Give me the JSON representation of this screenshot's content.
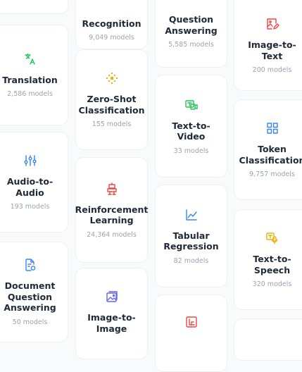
{
  "cards": [
    {
      "id": "recognition",
      "title_lines": [
        "",
        "Recognition"
      ],
      "count": "9,049 models",
      "icon": "none",
      "color": ""
    },
    {
      "id": "question-answering",
      "title_lines": [
        "Question",
        "Answering"
      ],
      "count": "5,585 models",
      "icon": "none",
      "color": ""
    },
    {
      "id": "translation",
      "title_lines": [
        "Translation"
      ],
      "count": "2,586 models",
      "icon": "translate-icon",
      "color": "#22c55e"
    },
    {
      "id": "zero-shot-classification",
      "title_lines": [
        "Zero-Shot",
        "Classification"
      ],
      "count": "155 models",
      "icon": "sparkle-icon",
      "color": "#eab308"
    },
    {
      "id": "image-to-text",
      "title_lines": [
        "Image-to-Text"
      ],
      "count": "200 models",
      "icon": "image-edit-icon",
      "color": "#ef4444"
    },
    {
      "id": "text-to-video",
      "title_lines": [
        "Text-to-Video"
      ],
      "count": "33 models",
      "icon": "video-icon",
      "color": "#22c55e"
    },
    {
      "id": "token-classification",
      "title_lines": [
        "Token",
        "Classification"
      ],
      "count": "9,757 models",
      "icon": "grid-icon",
      "color": "#3b82f6"
    },
    {
      "id": "audio-to-audio",
      "title_lines": [
        "Audio-to-Audio"
      ],
      "count": "193 models",
      "icon": "sliders-icon",
      "color": "#3b82f6"
    },
    {
      "id": "reinforcement-learning",
      "title_lines": [
        "Reinforcement",
        "Learning"
      ],
      "count": "24,364 models",
      "icon": "robot-icon",
      "color": "#ef4444"
    },
    {
      "id": "tabular-regression",
      "title_lines": [
        "Tabular",
        "Regression"
      ],
      "count": "82 models",
      "icon": "line-chart-icon",
      "color": "#3b82f6"
    },
    {
      "id": "text-to-speech",
      "title_lines": [
        "Text-to-Speech"
      ],
      "count": "320 models",
      "icon": "speech-icon",
      "color": "#eab308"
    },
    {
      "id": "document-question-answering",
      "title_lines": [
        "Document",
        "Question",
        "Answering"
      ],
      "count": "50 models",
      "icon": "document-icon",
      "color": "#3b82f6"
    },
    {
      "id": "image-to-image",
      "title_lines": [
        "Image-to-",
        "Image"
      ],
      "count": "",
      "icon": "image-icon",
      "color": "#6366f1"
    },
    {
      "id": "unnamed-task",
      "title_lines": [],
      "count": "",
      "icon": "crop-icon",
      "color": "#ef4444"
    }
  ]
}
